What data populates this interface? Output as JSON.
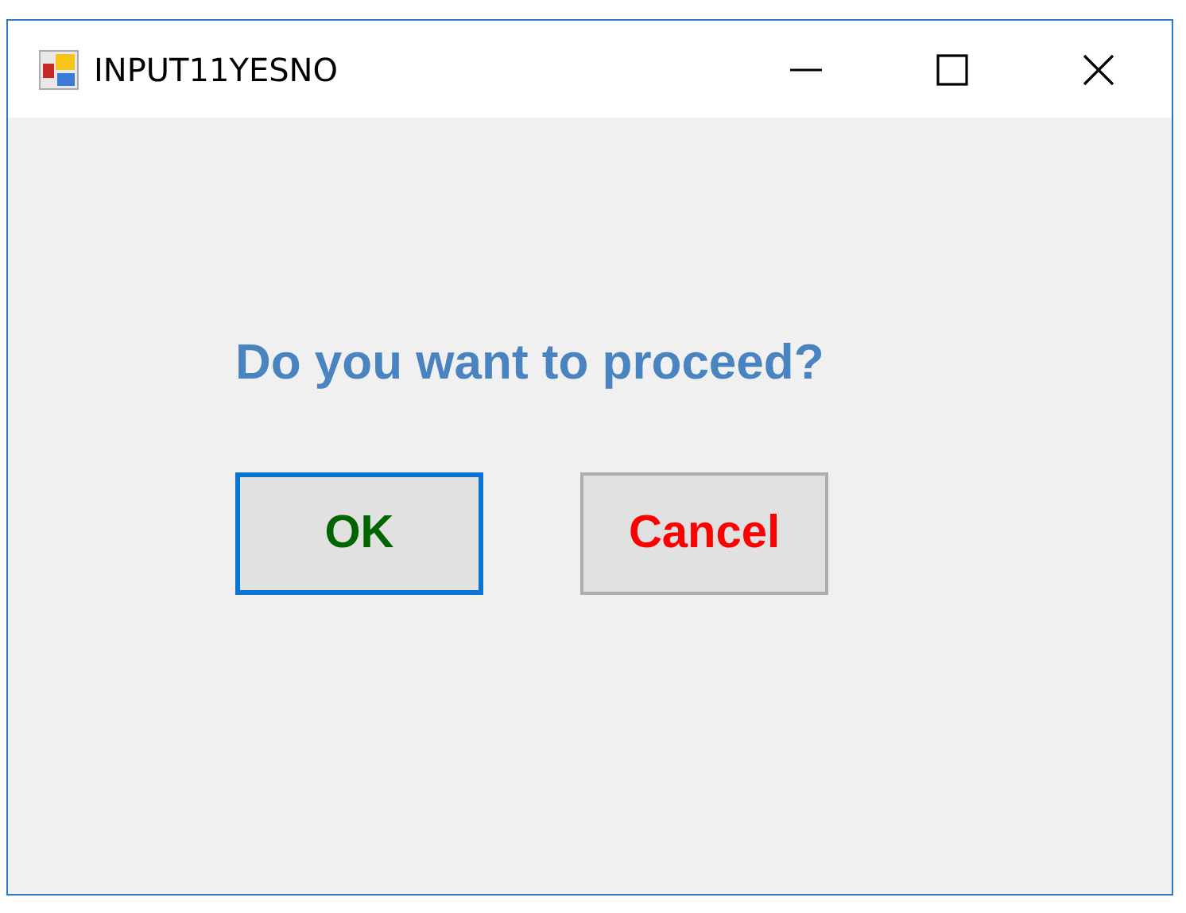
{
  "window": {
    "title": "INPUT11YESNO"
  },
  "prompt": "Do you want to proceed?",
  "buttons": [
    {
      "label": "OK",
      "color": "#006400",
      "focused": true
    },
    {
      "label": "Cancel",
      "color": "#ff0000",
      "focused": false
    }
  ]
}
